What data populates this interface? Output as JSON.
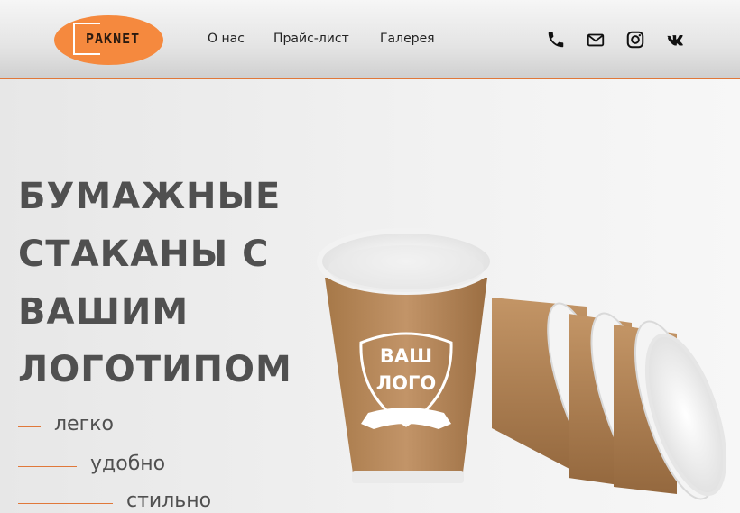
{
  "brand": {
    "name": "PAKNET"
  },
  "nav": {
    "items": [
      {
        "label": "О нас"
      },
      {
        "label": "Прайс-лист"
      },
      {
        "label": "Галерея"
      }
    ]
  },
  "contacts": {
    "icons": [
      "phone-icon",
      "mail-icon",
      "instagram-icon",
      "vk-icon"
    ]
  },
  "hero": {
    "title_lines": [
      "Бумажные",
      "стаканы с",
      "вашим",
      "логотипом"
    ],
    "features": [
      "легко",
      "удобно",
      "стильно"
    ],
    "cup_print": {
      "line1": "ВАШ",
      "line2": "ЛОГО"
    }
  },
  "colors": {
    "accent": "#e0783a",
    "logo_bg": "#f5893e",
    "kraft": "#b78a5c",
    "text": "#505050"
  }
}
